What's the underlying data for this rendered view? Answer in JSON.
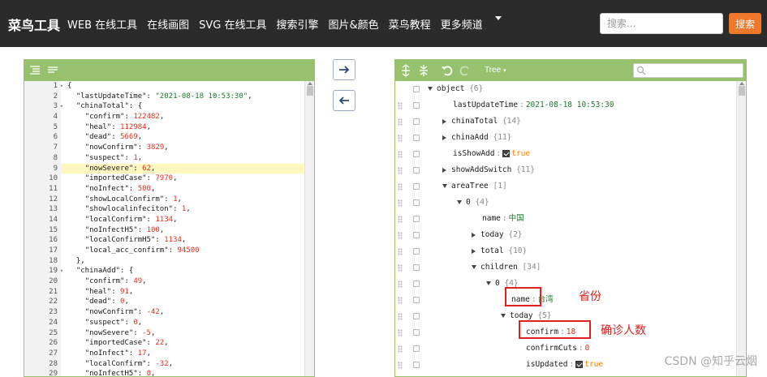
{
  "header": {
    "brand": "菜鸟工具",
    "nav": [
      {
        "label": "WEB 在线工具"
      },
      {
        "label": "在线画图"
      },
      {
        "label": "SVG 在线工具"
      },
      {
        "label": "搜索引擎"
      },
      {
        "label": "图片&颜色"
      },
      {
        "label": "菜鸟教程"
      },
      {
        "label": "更多频道"
      }
    ],
    "search_placeholder": "搜索...",
    "search_button": "搜索"
  },
  "editor": {
    "lines": [
      {
        "n": "1",
        "fold": "▾",
        "html": "{"
      },
      {
        "n": "2",
        "fold": "",
        "html": "  <span class='k'>\"lastUpdateTime\"</span>: <span class='s'>\"2021-08-18 10:53:30\"</span>,"
      },
      {
        "n": "3",
        "fold": "▾",
        "html": "  <span class='k'>\"chinaTotal\"</span>: {"
      },
      {
        "n": "4",
        "fold": "",
        "html": "    <span class='k'>\"confirm\"</span>: <span class='n'>122482</span>,"
      },
      {
        "n": "5",
        "fold": "",
        "html": "    <span class='k'>\"heal\"</span>: <span class='n'>112984</span>,"
      },
      {
        "n": "6",
        "fold": "",
        "html": "    <span class='k'>\"dead\"</span>: <span class='n'>5669</span>,"
      },
      {
        "n": "7",
        "fold": "",
        "html": "    <span class='k'>\"nowConfirm\"</span>: <span class='n'>3829</span>,"
      },
      {
        "n": "8",
        "fold": "",
        "html": "    <span class='k'>\"suspect\"</span>: <span class='n'>1</span>,"
      },
      {
        "n": "9",
        "fold": "",
        "html": "    <span class='k'>\"nowSevere\"</span>: <span class='n'>62</span>,"
      },
      {
        "n": "10",
        "fold": "",
        "html": "    <span class='k'>\"importedCase\"</span>: <span class='n'>7970</span>,"
      },
      {
        "n": "11",
        "fold": "",
        "html": "    <span class='k'>\"noInfect\"</span>: <span class='n'>500</span>,"
      },
      {
        "n": "12",
        "fold": "",
        "html": "    <span class='k'>\"showLocalConfirm\"</span>: <span class='n'>1</span>,"
      },
      {
        "n": "13",
        "fold": "",
        "html": "    <span class='k'>\"showlocalinfeciton\"</span>: <span class='n'>1</span>,"
      },
      {
        "n": "14",
        "fold": "",
        "html": "    <span class='k'>\"localConfirm\"</span>: <span class='n'>1134</span>,"
      },
      {
        "n": "15",
        "fold": "",
        "html": "    <span class='k'>\"noInfectH5\"</span>: <span class='n'>100</span>,"
      },
      {
        "n": "16",
        "fold": "",
        "html": "    <span class='k'>\"localConfirmH5\"</span>: <span class='n'>1134</span>,"
      },
      {
        "n": "17",
        "fold": "",
        "html": "    <span class='k'>\"local_acc_confirm\"</span>: <span class='n'>94500</span>"
      },
      {
        "n": "18",
        "fold": "",
        "html": "  },"
      },
      {
        "n": "19",
        "fold": "▾",
        "html": "  <span class='k'>\"chinaAdd\"</span>: {"
      },
      {
        "n": "20",
        "fold": "",
        "html": "    <span class='k'>\"confirm\"</span>: <span class='n'>49</span>,"
      },
      {
        "n": "21",
        "fold": "",
        "html": "    <span class='k'>\"heal\"</span>: <span class='n'>91</span>,"
      },
      {
        "n": "22",
        "fold": "",
        "html": "    <span class='k'>\"dead\"</span>: <span class='n'>0</span>,"
      },
      {
        "n": "23",
        "fold": "",
        "html": "    <span class='k'>\"nowConfirm\"</span>: <span class='n'>-42</span>,"
      },
      {
        "n": "24",
        "fold": "",
        "html": "    <span class='k'>\"suspect\"</span>: <span class='n'>0</span>,"
      },
      {
        "n": "25",
        "fold": "",
        "html": "    <span class='k'>\"nowSevere\"</span>: <span class='n'>-5</span>,"
      },
      {
        "n": "26",
        "fold": "",
        "html": "    <span class='k'>\"importedCase\"</span>: <span class='n'>22</span>,"
      },
      {
        "n": "27",
        "fold": "",
        "html": "    <span class='k'>\"noInfect\"</span>: <span class='n'>17</span>,"
      },
      {
        "n": "28",
        "fold": "",
        "html": "    <span class='k'>\"localConfirm\"</span>: <span class='n'>-32</span>,"
      },
      {
        "n": "29",
        "fold": "",
        "html": "    <span class='k'>\"noInfectH5\"</span>: <span class='n'>0</span>,"
      }
    ]
  },
  "tree": {
    "mode_label": "Tree",
    "rows": [
      {
        "indent": 0,
        "toggle": "down",
        "field": "object",
        "count": "{6}"
      },
      {
        "indent": 1,
        "toggle": "",
        "field": "lastUpdateTime",
        "sep": ":",
        "value": "2021-08-18 10:53:30",
        "vtype": "str"
      },
      {
        "indent": 1,
        "toggle": "right",
        "field": "chinaTotal",
        "count": "{14}"
      },
      {
        "indent": 1,
        "toggle": "right",
        "field": "chinaAdd",
        "count": "{11}"
      },
      {
        "indent": 1,
        "toggle": "",
        "field": "isShowAdd",
        "sep": ":",
        "value": "true",
        "vtype": "bool"
      },
      {
        "indent": 1,
        "toggle": "right",
        "field": "showAddSwitch",
        "count": "{11}"
      },
      {
        "indent": 1,
        "toggle": "down",
        "field": "areaTree",
        "count": "[1]"
      },
      {
        "indent": 2,
        "toggle": "down",
        "field": "0",
        "count": "{4}"
      },
      {
        "indent": 3,
        "toggle": "",
        "field": "name",
        "sep": ":",
        "value": "中国",
        "vtype": "str"
      },
      {
        "indent": 3,
        "toggle": "right",
        "field": "today",
        "count": "{2}"
      },
      {
        "indent": 3,
        "toggle": "right",
        "field": "total",
        "count": "{10}"
      },
      {
        "indent": 3,
        "toggle": "down",
        "field": "children",
        "count": "[34]"
      },
      {
        "indent": 4,
        "toggle": "down",
        "field": "0",
        "count": "{4}"
      },
      {
        "indent": 5,
        "toggle": "",
        "field": "name",
        "sep": ":",
        "value": "台湾",
        "vtype": "str"
      },
      {
        "indent": 5,
        "toggle": "down",
        "field": "today",
        "count": "{5}"
      },
      {
        "indent": 6,
        "toggle": "",
        "field": "confirm",
        "sep": ":",
        "value": "18",
        "vtype": "num"
      },
      {
        "indent": 6,
        "toggle": "",
        "field": "confirmCuts",
        "sep": ":",
        "value": "0",
        "vtype": "num"
      },
      {
        "indent": 6,
        "toggle": "",
        "field": "isUpdated",
        "sep": ":",
        "value": "true",
        "vtype": "bool"
      }
    ]
  },
  "annotations": {
    "province": "省份",
    "confirmed": "确诊人数"
  },
  "watermark": "CSDN @知乎云烟"
}
